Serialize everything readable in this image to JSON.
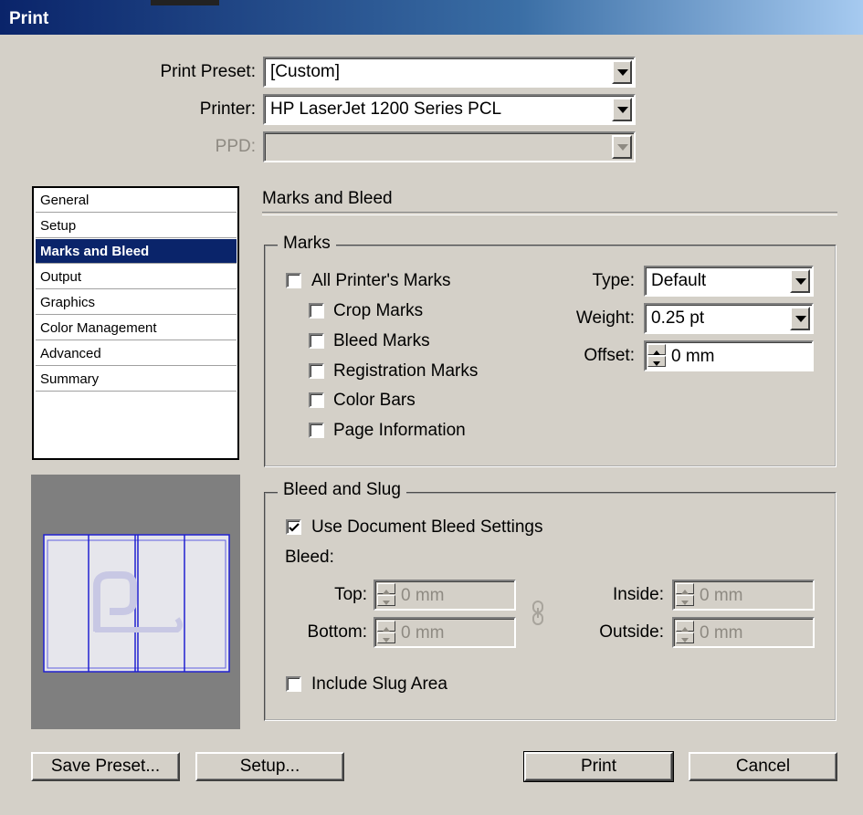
{
  "window": {
    "title": "Print"
  },
  "top_fields": {
    "print_preset": {
      "label": "Print Preset:",
      "value": "[Custom]"
    },
    "printer": {
      "label": "Printer:",
      "value": "HP LaserJet 1200 Series PCL"
    },
    "ppd": {
      "label": "PPD:",
      "value": ""
    }
  },
  "sidebar": {
    "items": [
      {
        "label": "General"
      },
      {
        "label": "Setup"
      },
      {
        "label": "Marks and Bleed",
        "selected": true
      },
      {
        "label": "Output"
      },
      {
        "label": "Graphics"
      },
      {
        "label": "Color Management"
      },
      {
        "label": "Advanced"
      },
      {
        "label": "Summary"
      }
    ]
  },
  "panel": {
    "title": "Marks and Bleed"
  },
  "marks": {
    "group_label": "Marks",
    "all_printers_marks": {
      "label": "All Printer's Marks",
      "checked": false
    },
    "crop_marks": {
      "label": "Crop Marks",
      "checked": false
    },
    "bleed_marks": {
      "label": "Bleed Marks",
      "checked": false
    },
    "registration_marks": {
      "label": "Registration Marks",
      "checked": false
    },
    "color_bars": {
      "label": "Color Bars",
      "checked": false
    },
    "page_information": {
      "label": "Page Information",
      "checked": false
    },
    "type": {
      "label": "Type:",
      "value": "Default"
    },
    "weight": {
      "label": "Weight:",
      "value": "0.25 pt"
    },
    "offset": {
      "label": "Offset:",
      "value": "0 mm"
    }
  },
  "bleed_slug": {
    "group_label": "Bleed and Slug",
    "use_document_bleed": {
      "label": "Use Document Bleed Settings",
      "checked": true
    },
    "bleed_label": "Bleed:",
    "top": {
      "label": "Top:",
      "value": "0 mm"
    },
    "bottom": {
      "label": "Bottom:",
      "value": "0 mm"
    },
    "inside": {
      "label": "Inside:",
      "value": "0 mm"
    },
    "outside": {
      "label": "Outside:",
      "value": "0 mm"
    },
    "include_slug": {
      "label": "Include Slug Area",
      "checked": false
    }
  },
  "buttons": {
    "save_preset": "Save Preset...",
    "setup": "Setup...",
    "print": "Print",
    "cancel": "Cancel"
  },
  "colors": {
    "titlebar_start": "#0a246a",
    "titlebar_end": "#a6caf0",
    "selection": "#0a246a",
    "face": "#d4d0c8",
    "preview_lines": "#2020d0"
  },
  "icons": {
    "dropdown": "chevron-down-icon",
    "chain_link": "chain-link-icon",
    "check": "check-icon"
  }
}
